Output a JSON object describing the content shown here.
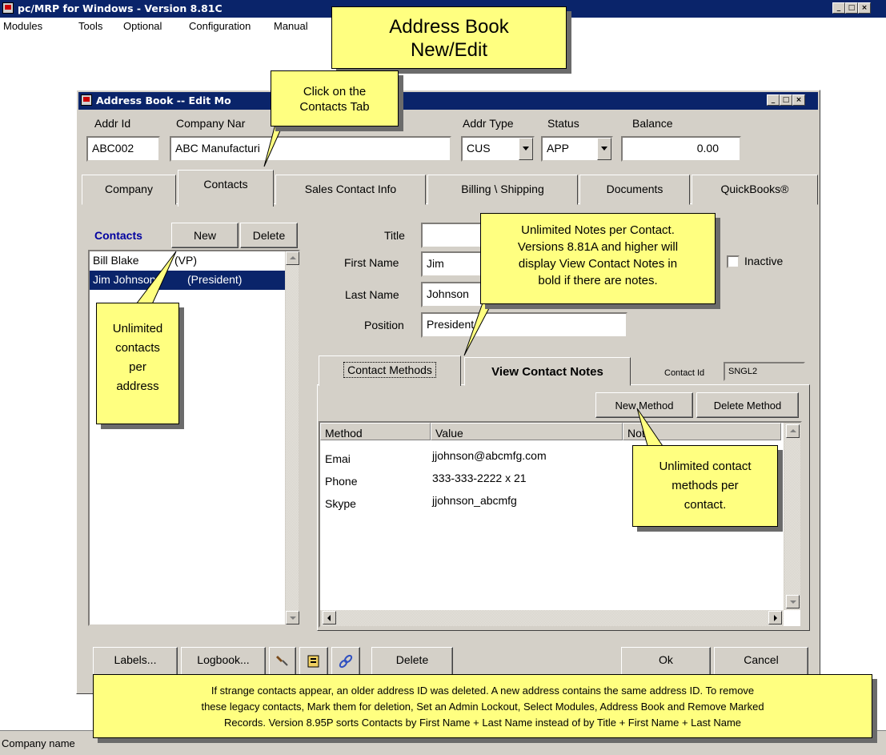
{
  "app": {
    "title": "pc/MRP for Windows - Version 8.81C",
    "menu": [
      "Modules",
      "Tools",
      "Optional",
      "Configuration",
      "Manual"
    ],
    "status_text": "Company name"
  },
  "dialog": {
    "title": "Address Book -- Edit Mo",
    "labels": {
      "addr_id": "Addr Id",
      "company_name": "Company Nar",
      "addr_type": "Addr Type",
      "status": "Status",
      "balance": "Balance"
    },
    "values": {
      "addr_id": "ABC002",
      "company_name": "ABC Manufacturi",
      "addr_type": "CUS",
      "status": "APP",
      "balance": "0.00"
    },
    "tabs": [
      "Company",
      "Contacts",
      "Sales Contact Info",
      "Billing \\ Shipping",
      "Documents",
      "QuickBooks®"
    ],
    "contacts": {
      "header": "Contacts",
      "new_btn": "New",
      "delete_btn": "Delete",
      "items": [
        {
          "name": "Bill Blake",
          "title": "(VP)"
        },
        {
          "name": "Jim Johnson",
          "title": "(President)"
        }
      ]
    },
    "detail": {
      "title_label": "Title",
      "first_name_label": "First Name",
      "last_name_label": "Last Name",
      "position_label": "Position",
      "first_name": "Jim",
      "last_name": "Johnson",
      "position": "President",
      "inactive_label": "Inactive"
    },
    "subtabs": {
      "methods": "Contact Methods",
      "notes": "View Contact Notes",
      "contact_id_label": "Contact Id",
      "contact_id": "SNGL2"
    },
    "method_buttons": {
      "new": "New Method",
      "delete": "Delete Method"
    },
    "methods_table": {
      "columns": [
        "Method",
        "Value",
        "Note"
      ],
      "rows": [
        {
          "method": "Emai",
          "value": "jjohnson@abcmfg.com"
        },
        {
          "method": "Phone",
          "value": "333-333-2222 x 21"
        },
        {
          "method": "Skype",
          "value": "jjohnson_abcmfg"
        }
      ]
    },
    "bottom_buttons": {
      "labels": "Labels...",
      "logbook": "Logbook...",
      "delete": "Delete",
      "ok": "Ok",
      "cancel": "Cancel"
    }
  },
  "callouts": {
    "main_title_1": "Address Book",
    "main_title_2": "New/Edit",
    "contacts_tab_1": "Click on the",
    "contacts_tab_2": "Contacts Tab",
    "notes_1": "Unlimited Notes per Contact.",
    "notes_2": "Versions 8.81A and higher will",
    "notes_3": "display View Contact Notes in",
    "notes_4": "bold if there are notes.",
    "unlimited_1": "Unlimited",
    "unlimited_2": "contacts",
    "unlimited_3": "per",
    "unlimited_4": "address",
    "methods_1": "Unlimited contact",
    "methods_2": "methods per",
    "methods_3": "contact.",
    "bottom_1": "If strange contacts appear, an older address ID was deleted.  A new address contains the same address ID.  To remove",
    "bottom_2": "these legacy contacts, Mark them for deletion, Set an Admin Lockout, Select Modules, Address Book and Remove Marked",
    "bottom_3": "Records.  Version 8.95P sorts Contacts by First Name + Last Name instead of by Title + First Name + Last Name"
  },
  "colors": {
    "titlebar": "#0a246a",
    "dialog_bg": "#d4d0c8",
    "callout_bg": "#ffff80",
    "selection": "#0a246a",
    "contacts_header": "#0000a0"
  }
}
